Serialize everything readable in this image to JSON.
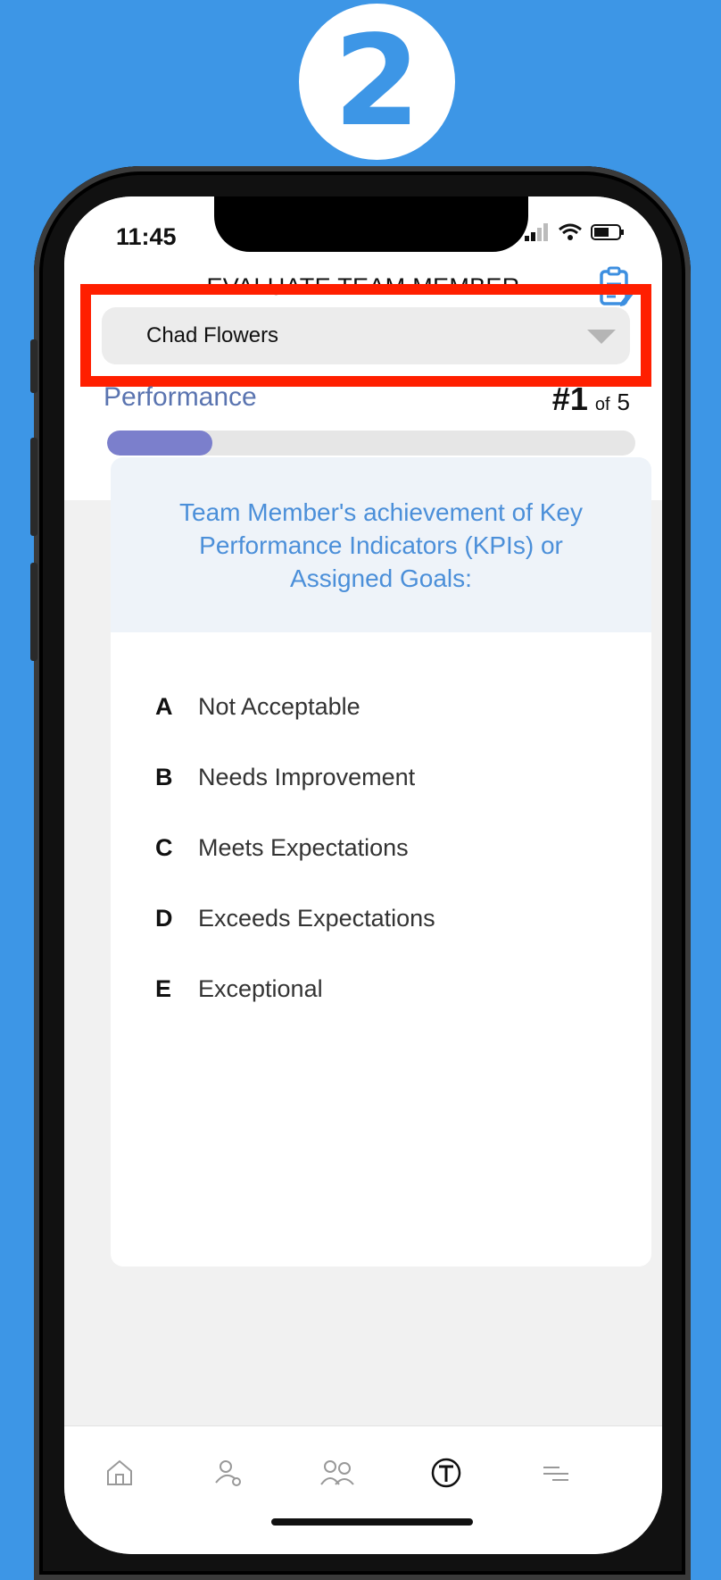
{
  "step": {
    "number": "2"
  },
  "status_bar": {
    "time": "11:45"
  },
  "header": {
    "title": "EVALUATE TEAM MEMBER"
  },
  "selector": {
    "selected": "Chad Flowers"
  },
  "section": {
    "label": "Performance",
    "current": "#1",
    "of_label": "of",
    "total": "5",
    "progress_fraction": 0.2
  },
  "question": {
    "text": "Team Member's achievement of Key Performance Indicators (KPIs) or Assigned Goals:"
  },
  "options": [
    {
      "letter": "A",
      "text": "Not Acceptable"
    },
    {
      "letter": "B",
      "text": "Needs Improvement"
    },
    {
      "letter": "C",
      "text": "Meets Expectations"
    },
    {
      "letter": "D",
      "text": "Exceeds Expectations"
    },
    {
      "letter": "E",
      "text": "Exceptional"
    }
  ],
  "tabbar": {
    "items": [
      "home-icon",
      "user-badge-icon",
      "team-icon",
      "t-logo-icon",
      "menu-icon"
    ]
  },
  "colors": {
    "background": "#3d96e6",
    "highlight": "#ff1f00",
    "progress": "#7b7fcc",
    "question_text": "#4b8fd9"
  }
}
